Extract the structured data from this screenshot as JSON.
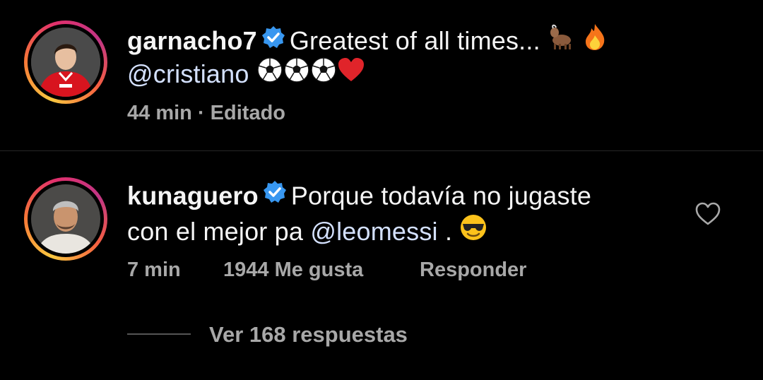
{
  "comments": [
    {
      "username": "garnacho7",
      "verified": true,
      "text_line1": "Greatest of all times...",
      "mention": "@cristiano",
      "time": "44 min",
      "separator": "·",
      "edited": "Editado",
      "emojis_line1": [
        "goat-emoji",
        "fire-emoji"
      ],
      "emojis_line2": [
        "soccer-ball-emoji",
        "soccer-ball-emoji",
        "soccer-ball-emoji",
        "red-heart-emoji"
      ]
    },
    {
      "username": "kunaguero",
      "verified": true,
      "text_line1": "Porque todavía no jugaste",
      "text_line2_prefix": "con el mejor pa",
      "mention": "@leomessi",
      "text_line2_suffix": ".",
      "emojis_line2": [
        "sunglasses-emoji"
      ],
      "time": "7 min",
      "likes": "1944 Me gusta",
      "reply": "Responder"
    }
  ],
  "view_replies": "Ver 168 respuestas",
  "colors": {
    "background": "#000000",
    "text": "#f5f5f5",
    "muted": "#a8a8a8",
    "mention": "#d4e1ff",
    "verified": "#3897f0"
  }
}
